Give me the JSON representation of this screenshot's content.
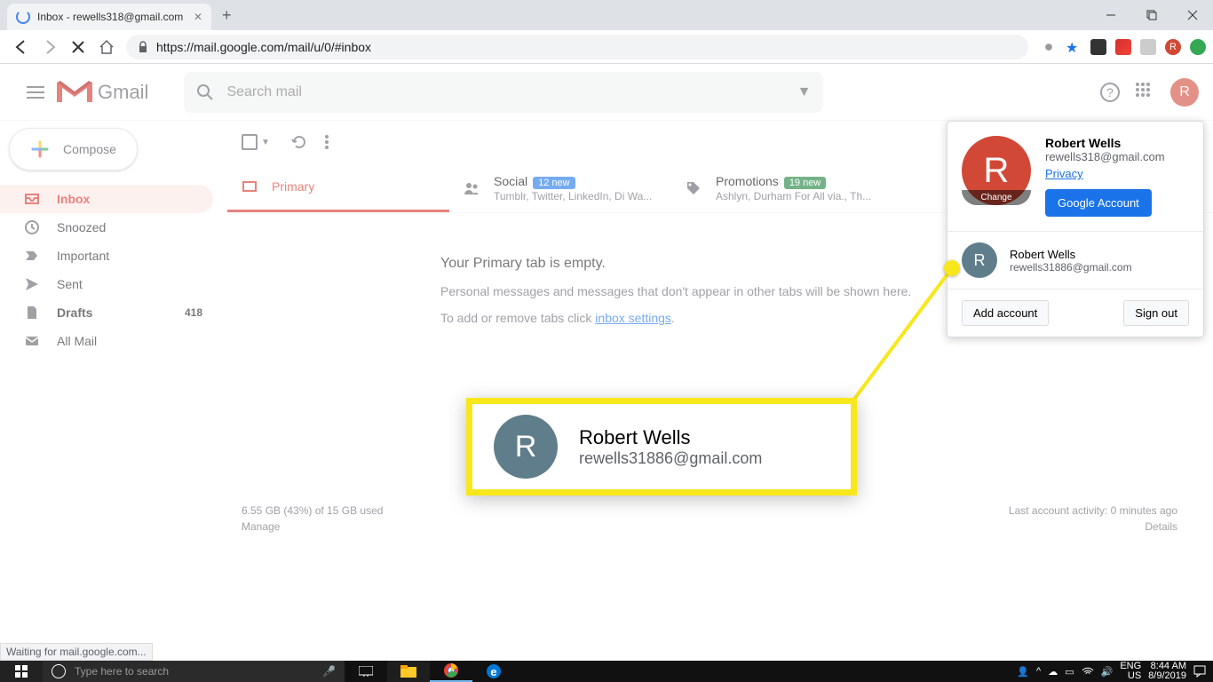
{
  "browser": {
    "tab_title": "Inbox - rewells318@gmail.com",
    "url": "https://mail.google.com/mail/u/0/#inbox",
    "status_text": "Waiting for mail.google.com..."
  },
  "header": {
    "logo_text": "Gmail",
    "search_placeholder": "Search mail",
    "avatar_letter": "R"
  },
  "compose_label": "Compose",
  "sidebar": {
    "items": [
      {
        "label": "Inbox",
        "active": true
      },
      {
        "label": "Snoozed"
      },
      {
        "label": "Important"
      },
      {
        "label": "Sent"
      },
      {
        "label": "Drafts",
        "count": "418",
        "bold": true
      },
      {
        "label": "All Mail"
      }
    ]
  },
  "tabs": {
    "primary": {
      "label": "Primary"
    },
    "social": {
      "label": "Social",
      "badge": "12 new",
      "sub": "Tumblr, Twitter, LinkedIn, Di Wa..."
    },
    "promotions": {
      "label": "Promotions",
      "badge": "19 new",
      "sub": "Ashlyn, Durham For All via., Th..."
    }
  },
  "empty": {
    "title": "Your Primary tab is empty.",
    "line1": "Personal messages and messages that don't appear in other tabs will be shown here.",
    "line2_prefix": "To add or remove tabs click ",
    "line2_link": "inbox settings",
    "line2_suffix": "."
  },
  "footer": {
    "storage": "6.55 GB (43%) of 15 GB used",
    "manage": "Manage",
    "activity": "Last account activity: 0 minutes ago",
    "details": "Details"
  },
  "popup": {
    "avatar_letter": "R",
    "change": "Change",
    "name": "Robert Wells",
    "email": "rewells318@gmail.com",
    "privacy": "Privacy",
    "account_btn": "Google Account",
    "alt_avatar_letter": "R",
    "alt_name": "Robert Wells",
    "alt_email": "rewells31886@gmail.com",
    "add_account": "Add account",
    "sign_out": "Sign out"
  },
  "callout": {
    "avatar_letter": "R",
    "name": "Robert Wells",
    "email": "rewells31886@gmail.com"
  },
  "taskbar": {
    "search_placeholder": "Type here to search",
    "lang1": "ENG",
    "lang2": "US",
    "time": "8:44 AM",
    "date": "8/9/2019"
  }
}
